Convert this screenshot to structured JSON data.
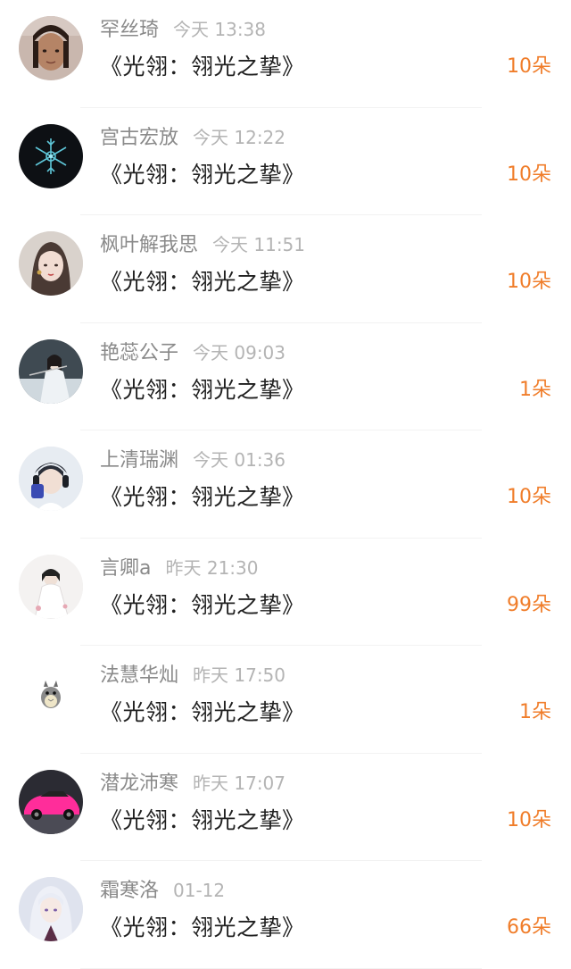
{
  "accent_color": "#f07d2a",
  "items": [
    {
      "name": "罕丝琦",
      "time": "今天 13:38",
      "title": "《光翎：翎光之挚》",
      "count": "10朵",
      "avatar_icon": "girl-selfie-avatar"
    },
    {
      "name": "宫古宏放",
      "time": "今天 12:22",
      "title": "《光翎：翎光之挚》",
      "count": "10朵",
      "avatar_icon": "snowflake-dark-avatar"
    },
    {
      "name": "枫叶解我思",
      "time": "今天 11:51",
      "title": "《光翎：翎光之挚》",
      "count": "10朵",
      "avatar_icon": "illustrated-girl-avatar"
    },
    {
      "name": "艳蕊公子",
      "time": "今天 09:03",
      "title": "《光翎：翎光之挚》",
      "count": "1朵",
      "avatar_icon": "ancient-swordsman-avatar"
    },
    {
      "name": "上清瑞渊",
      "time": "今天 01:36",
      "title": "《光翎：翎光之挚》",
      "count": "10朵",
      "avatar_icon": "boy-headphones-avatar"
    },
    {
      "name": "言卿a",
      "time": "昨天 21:30",
      "title": "《光翎：翎光之挚》",
      "count": "99朵",
      "avatar_icon": "white-robed-figure-avatar"
    },
    {
      "name": "法慧华灿",
      "time": "昨天 17:50",
      "title": "《光翎：翎光之挚》",
      "count": "1朵",
      "avatar_icon": "totoro-avatar"
    },
    {
      "name": "潜龙沛寒",
      "time": "昨天 17:07",
      "title": "《光翎：翎光之挚》",
      "count": "10朵",
      "avatar_icon": "pink-sports-car-avatar"
    },
    {
      "name": "霜寒洛",
      "time": "01-12",
      "title": "《光翎：翎光之挚》",
      "count": "66朵",
      "avatar_icon": "silver-hair-girl-avatar"
    }
  ]
}
